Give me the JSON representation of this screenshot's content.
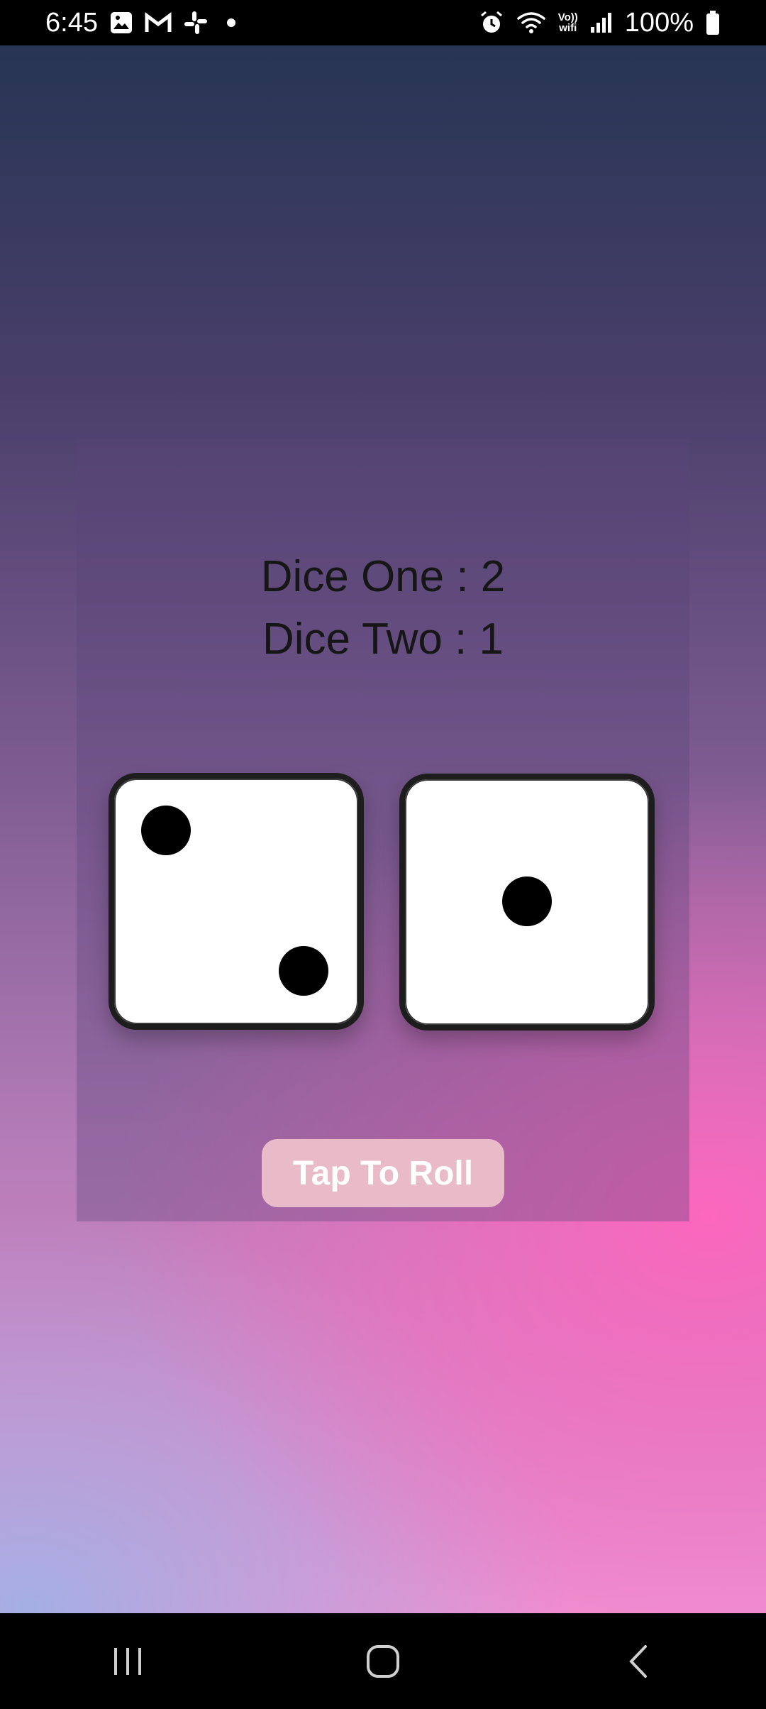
{
  "status_bar": {
    "time": "6:45",
    "battery_percent": "100%",
    "volte_label_top": "Vo))",
    "volte_label_bottom": "wifi",
    "left_icons": [
      "gallery-icon",
      "gmail-icon",
      "slack-icon",
      "notification-dot-icon"
    ],
    "right_icons": [
      "alarm-icon",
      "wifi-icon",
      "volte-wifi-icon",
      "signal-icon",
      "battery-icon"
    ]
  },
  "dice": {
    "one_text": "Dice One : 2",
    "two_text": "Dice Two : 1",
    "one_value": 2,
    "two_value": 1
  },
  "button": {
    "roll_label": "Tap To Roll"
  },
  "nav_bar": {
    "buttons": [
      "recent-apps-icon",
      "home-icon",
      "back-icon"
    ]
  },
  "colors": {
    "button_bg": "#e9bac8",
    "die_border": "#1d1d1d",
    "pip": "#000000"
  }
}
